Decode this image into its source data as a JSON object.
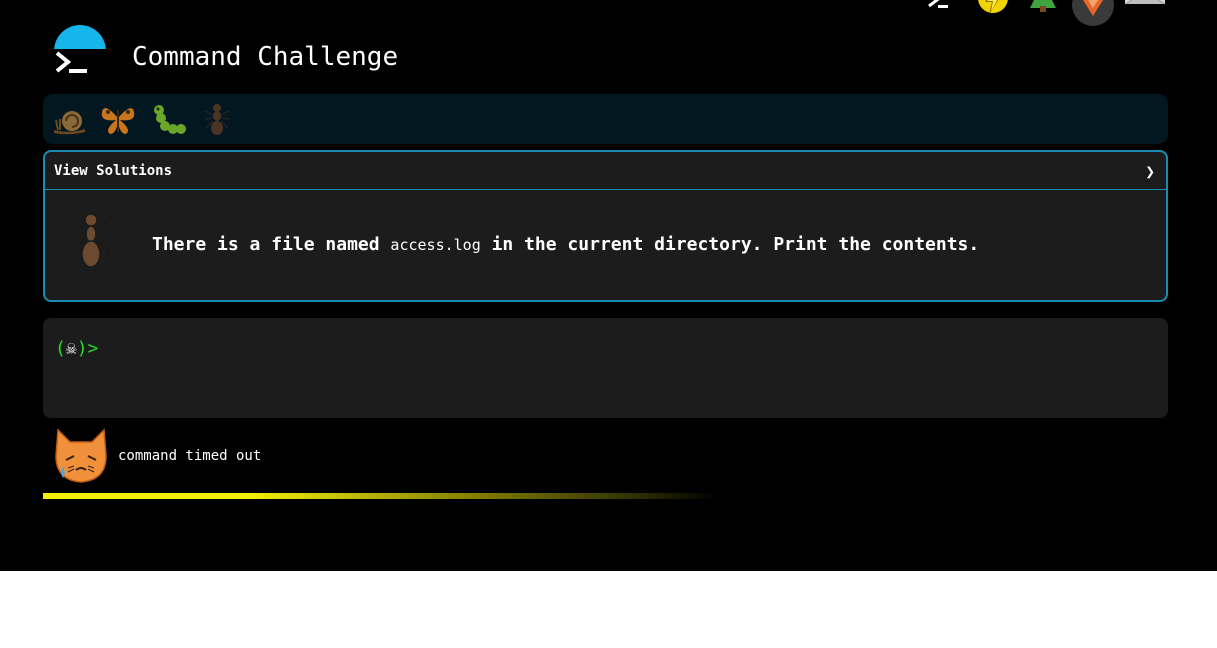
{
  "header": {
    "title": "Command Challenge"
  },
  "top_icons": [
    "terminal-icon",
    "lightning-bolt-icon",
    "tree-icon",
    "profile-badge-icon",
    "mail-icon"
  ],
  "levels": [
    {
      "icon": "snail-icon"
    },
    {
      "icon": "butterfly-icon"
    },
    {
      "icon": "caterpillar-icon"
    },
    {
      "icon": "ant-icon"
    }
  ],
  "solutions": {
    "label": "View Solutions",
    "toggle": "❯"
  },
  "challenge": {
    "text_before": "There is a file named ",
    "filename": "access.log",
    "text_after": " in the current directory. Print the contents."
  },
  "terminal": {
    "prompt_open": "(",
    "prompt_symbol": "☠",
    "prompt_close": ")>",
    "input_value": ""
  },
  "status": {
    "message": "command timed out",
    "progress": 0.6
  },
  "colors": {
    "background": "#000000",
    "accent": "#1a8cb0",
    "logo_blue": "#16b5ea",
    "prompt_green": "#27d927",
    "progress_yellow": "#f5f000",
    "panel": "#1c1c1c",
    "level_bar": "#021720"
  }
}
